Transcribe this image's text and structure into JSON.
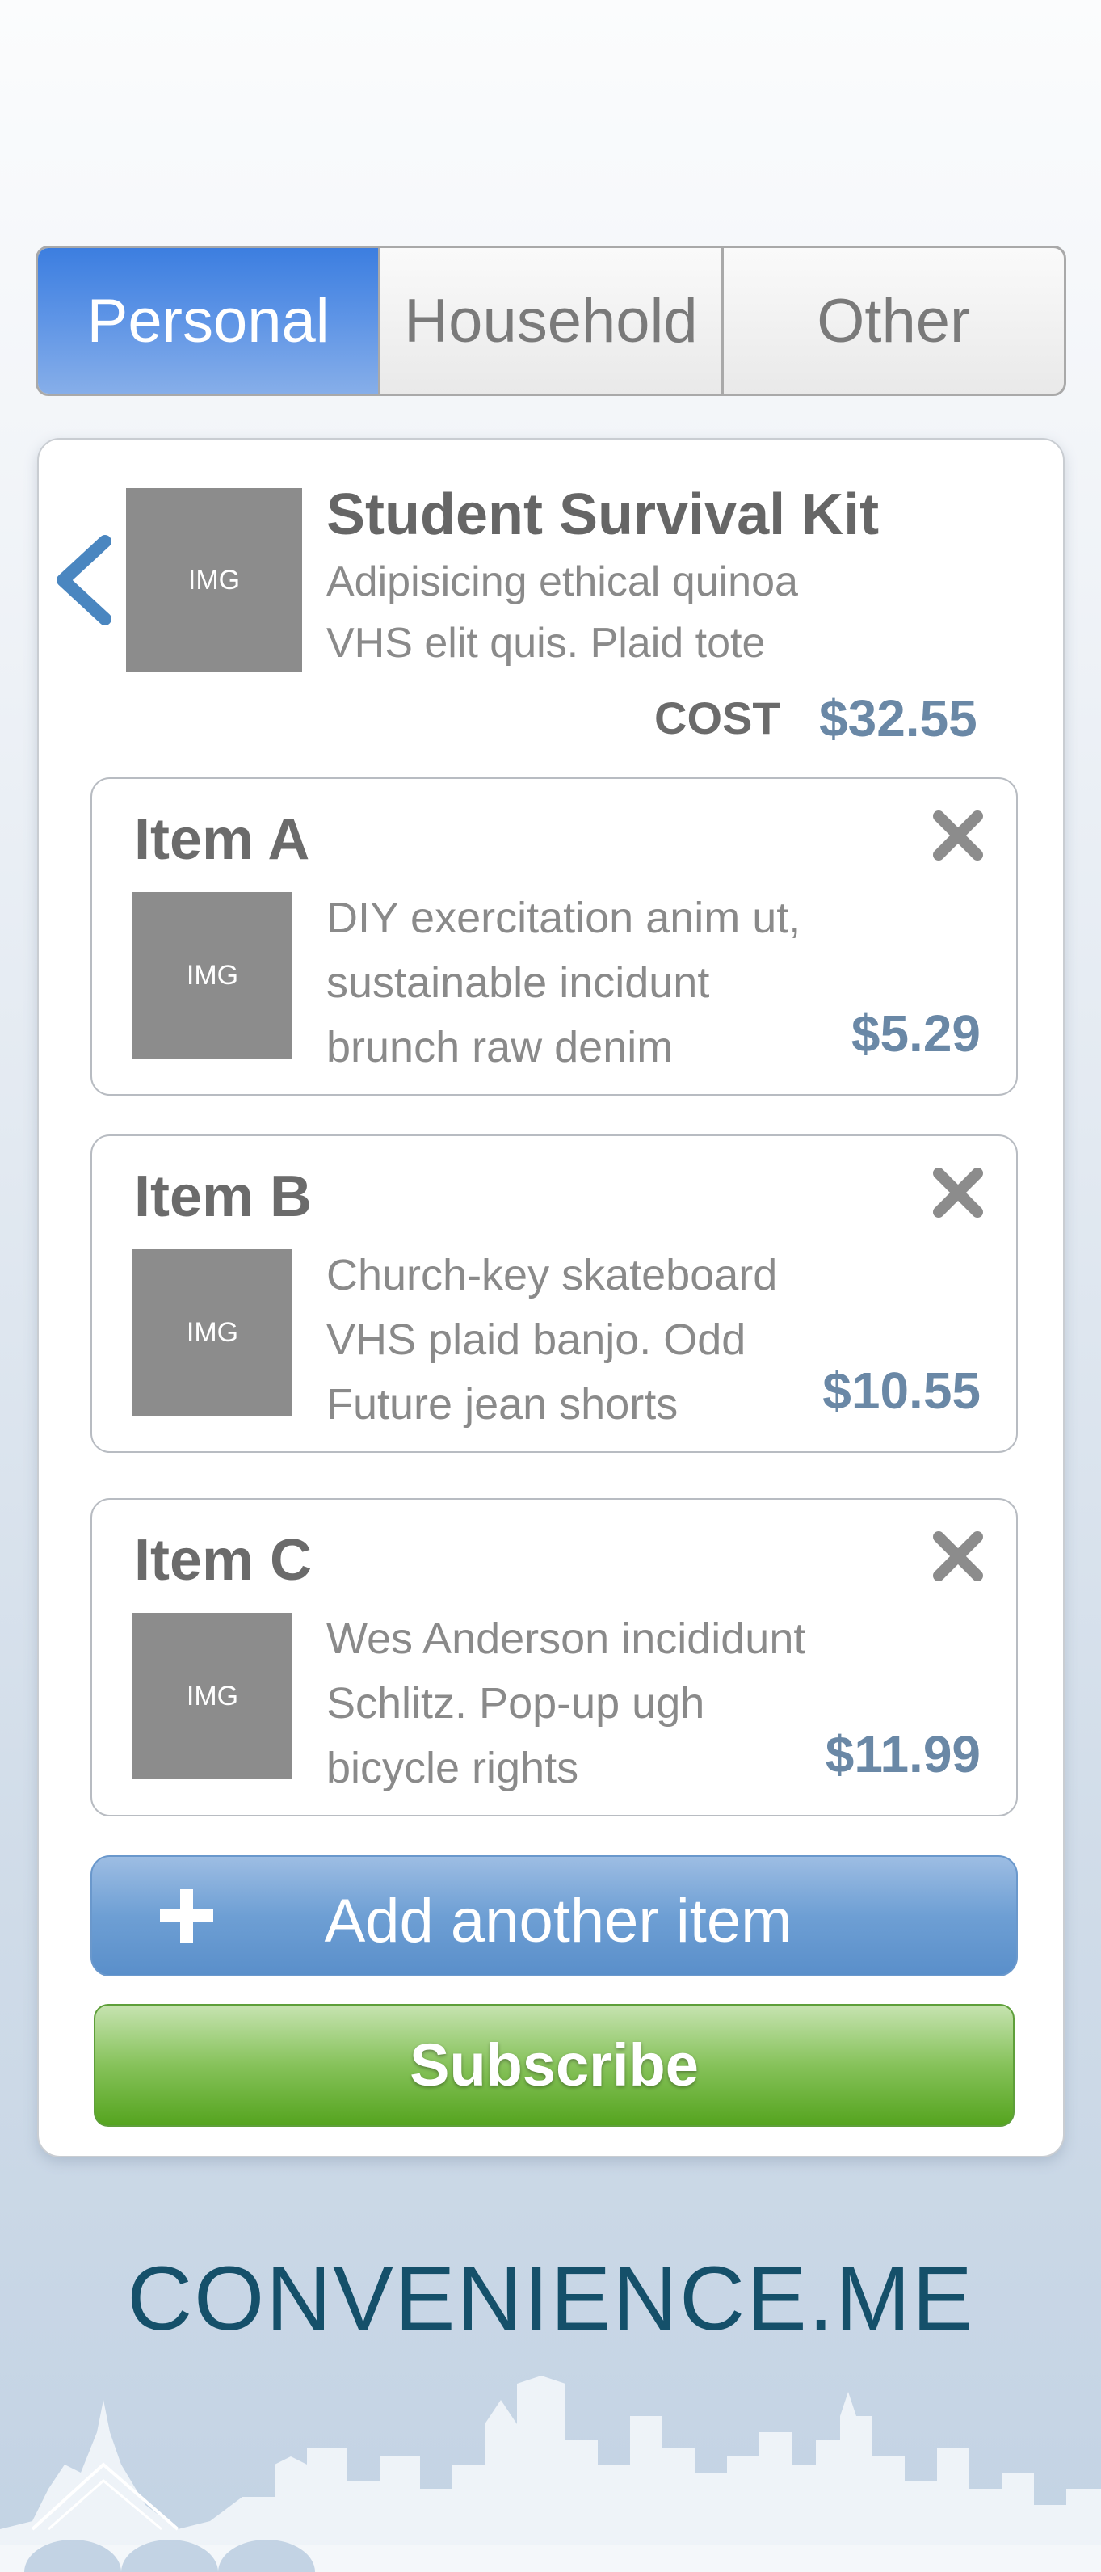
{
  "tabs": [
    {
      "label": "Personal",
      "active": true
    },
    {
      "label": "Household",
      "active": false
    },
    {
      "label": "Other",
      "active": false
    }
  ],
  "kit": {
    "img_label": "IMG",
    "title": "Student Survival Kit",
    "description": "Adipisicing ethical quinoa VHS elit quis. Plaid tote",
    "cost_label": "COST",
    "cost_value": "$32.55"
  },
  "items": [
    {
      "title": "Item A",
      "img_label": "IMG",
      "description": "DIY exercitation anim ut, sustainable incidunt brunch raw denim",
      "price": "$5.29"
    },
    {
      "title": "Item B",
      "img_label": "IMG",
      "description": "Church-key skateboard VHS plaid banjo. Odd Future jean shorts",
      "price": "$10.55"
    },
    {
      "title": "Item C",
      "img_label": "IMG",
      "description": "Wes Anderson incididunt Schlitz. Pop-up ugh bicycle rights",
      "price": "$11.99"
    }
  ],
  "actions": {
    "add_label": "Add another item",
    "subscribe_label": "Subscribe"
  },
  "brand": "CONVENIENCE.ME",
  "colors": {
    "tab_active": "#4a86e2",
    "price": "#6a88a6",
    "add_button": "#6e9fd4",
    "subscribe_button": "#6db33f",
    "brand": "#15506a"
  },
  "icons": {
    "back": "chevron-left-icon",
    "remove": "close-icon",
    "add": "plus-icon"
  }
}
